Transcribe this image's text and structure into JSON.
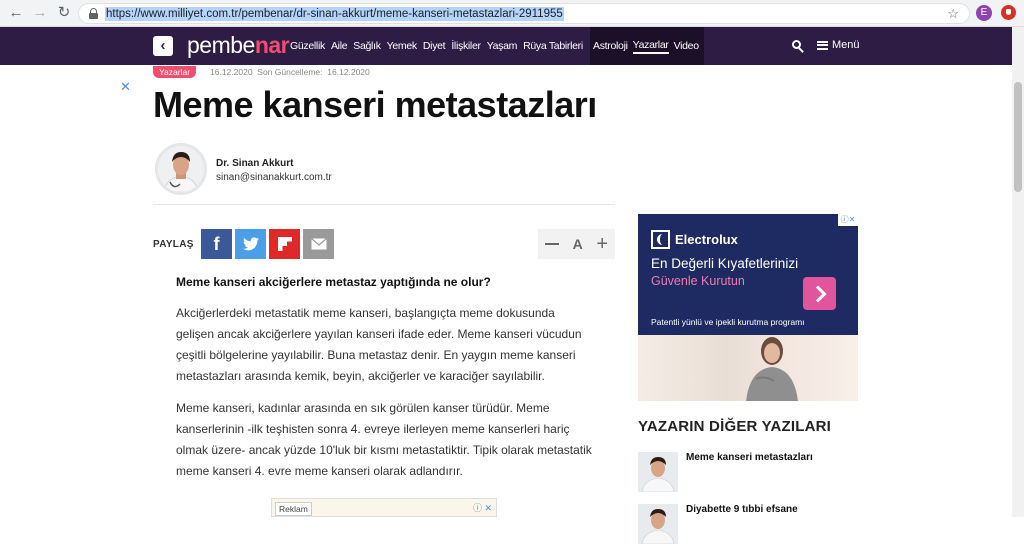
{
  "browser": {
    "url": "https://www.milliyet.com.tr/pembenar/dr-sinan-akkurt/meme-kanseri-metastazlari-2911955",
    "profile_initial": "E"
  },
  "header": {
    "logo_prefix": "pembe",
    "logo_suffix": "nar",
    "menu_items": [
      "Güzellik",
      "Aile",
      "Sağlık",
      "Yemek",
      "Diyet",
      "İlişkiler",
      "Yaşam",
      "Rüya Tabirleri"
    ],
    "dark_menu_items": [
      "Astroloji",
      "Yazarlar",
      "Video"
    ],
    "menu_label": "Menü"
  },
  "article": {
    "category": "Yazarlar",
    "date": "16.12.2020",
    "updated_label": "Son Güncelleme:",
    "updated_date": "16.12.2020",
    "title": "Meme kanseri metastazları",
    "author_name": "Dr. Sinan Akkurt",
    "author_email": "sinan@sinanakkurt.com.tr",
    "share_label": "PAYLAŞ",
    "font_label": "A",
    "question": "Meme kanseri akciğerlere metastaz yaptığında ne olur?",
    "paragraphs": [
      "Akciğerlerdeki metastatik meme kanseri, başlangıçta meme dokusunda gelişen ancak akciğerlere yayılan kanseri ifade eder. Meme kanseri vücudun çeşitli bölgelerine yayılabilir. Buna metastaz denir. En yaygın meme kanseri metastazları arasında kemik, beyin, akciğerler ve karaciğer sayılabilir.",
      "Meme kanseri, kadınlar arasında en sık görülen kanser türüdür. Meme kanserlerinin -ilk teşhisten sonra 4. evreye ilerleyen meme kanserleri hariç olmak üzere- ancak yüzde 10'luk bir kısmı metastatiktir. Tipik olarak metastatik meme kanseri 4. evre meme kanseri olarak adlandırır."
    ],
    "ad_label": "Reklam"
  },
  "ad": {
    "brand": "Electrolux",
    "headline": "En Değerli Kıyafetlerinizi",
    "subheadline": "Güvenle Kurutun",
    "caption": "Patentli yünlü ve ipekli kurutma programı"
  },
  "sidebar": {
    "title": "YAZARIN DİĞER YAZILARI",
    "items": [
      {
        "label": "Meme kanseri metastazları"
      },
      {
        "label": "Diyabette 9 tıbbi efsane"
      }
    ]
  },
  "colors": {
    "header_bg": "#2e1c45",
    "accent_pink": "#f04e6f",
    "facebook": "#3b5998",
    "twitter": "#4a9fe8",
    "flipboard": "#e12828",
    "mail": "#9a9a9a",
    "ad_navy": "#1e2b63"
  }
}
